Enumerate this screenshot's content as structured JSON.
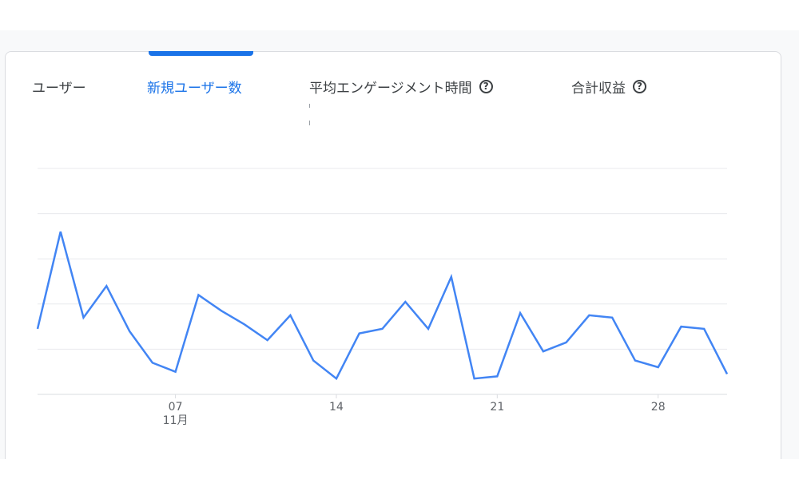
{
  "tabs": [
    {
      "label": "ユーザー",
      "active": false,
      "help": false
    },
    {
      "label": "新規ユーザー数",
      "active": true,
      "help": false
    },
    {
      "label": "平均エンゲージメント時間",
      "active": false,
      "help": true
    },
    {
      "label": "合計収益",
      "active": false,
      "help": true
    }
  ],
  "help_icon_glyph": "?",
  "colors": {
    "accent": "#1a73e8",
    "line": "#4285f4",
    "gridline": "#e8eaed",
    "text": "#3c4043",
    "tick_text": "#5f6368"
  },
  "chart_data": {
    "type": "line",
    "title": "",
    "xlabel": "",
    "ylabel": "",
    "x_tick_labels": [
      {
        "day": 7,
        "label": "07",
        "sublabel": "11月"
      },
      {
        "day": 14,
        "label": "14",
        "sublabel": ""
      },
      {
        "day": 21,
        "label": "21",
        "sublabel": ""
      },
      {
        "day": 28,
        "label": "28",
        "sublabel": ""
      }
    ],
    "grid": true,
    "y_tick_labels_visible": false,
    "ylim": [
      0,
      100
    ],
    "series": [
      {
        "x": [
          1,
          2,
          3,
          4,
          5,
          6,
          7,
          8,
          9,
          10,
          11,
          12,
          13,
          14,
          15,
          16,
          17,
          18,
          19,
          20,
          21,
          22,
          23,
          24,
          25,
          26,
          27,
          28,
          29,
          30,
          31
        ],
        "values": [
          29,
          72,
          34,
          48,
          28,
          14,
          10,
          44,
          37,
          31,
          24,
          35,
          15,
          7,
          27,
          29,
          41,
          29,
          52,
          7,
          8,
          36,
          19,
          23,
          35,
          34,
          15,
          12,
          30,
          29,
          9
        ]
      }
    ]
  }
}
